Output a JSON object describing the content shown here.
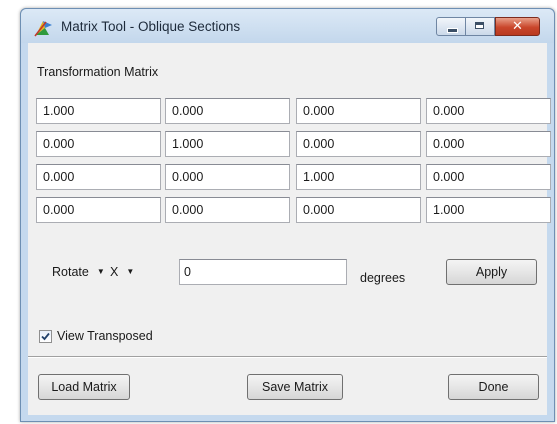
{
  "window": {
    "title": "Matrix Tool - Oblique Sections",
    "icon": "matrix-tool-app-icon",
    "controls": {
      "minimize_icon": "minimize-icon",
      "maximize_icon": "maximize-icon",
      "close_glyph": "✕"
    }
  },
  "matrix": {
    "label": "Transformation Matrix",
    "rows": [
      [
        "1.000",
        "0.000",
        "0.000",
        "0.000"
      ],
      [
        "0.000",
        "1.000",
        "0.000",
        "0.000"
      ],
      [
        "0.000",
        "0.000",
        "1.000",
        "0.000"
      ],
      [
        "0.000",
        "0.000",
        "0.000",
        "1.000"
      ]
    ]
  },
  "rotate": {
    "operation": "Rotate",
    "axis": "X",
    "angle": "0",
    "units": "degrees",
    "dropdown_arrow": "▼",
    "apply_label": "Apply"
  },
  "options": {
    "view_transposed_label": "View Transposed",
    "view_transposed_checked": true
  },
  "footer": {
    "load_label": "Load Matrix",
    "save_label": "Save Matrix",
    "done_label": "Done"
  },
  "colors": {
    "titlebar": "#c5d9ee",
    "client": "#f0f0f0",
    "close_button": "#c9462b"
  }
}
